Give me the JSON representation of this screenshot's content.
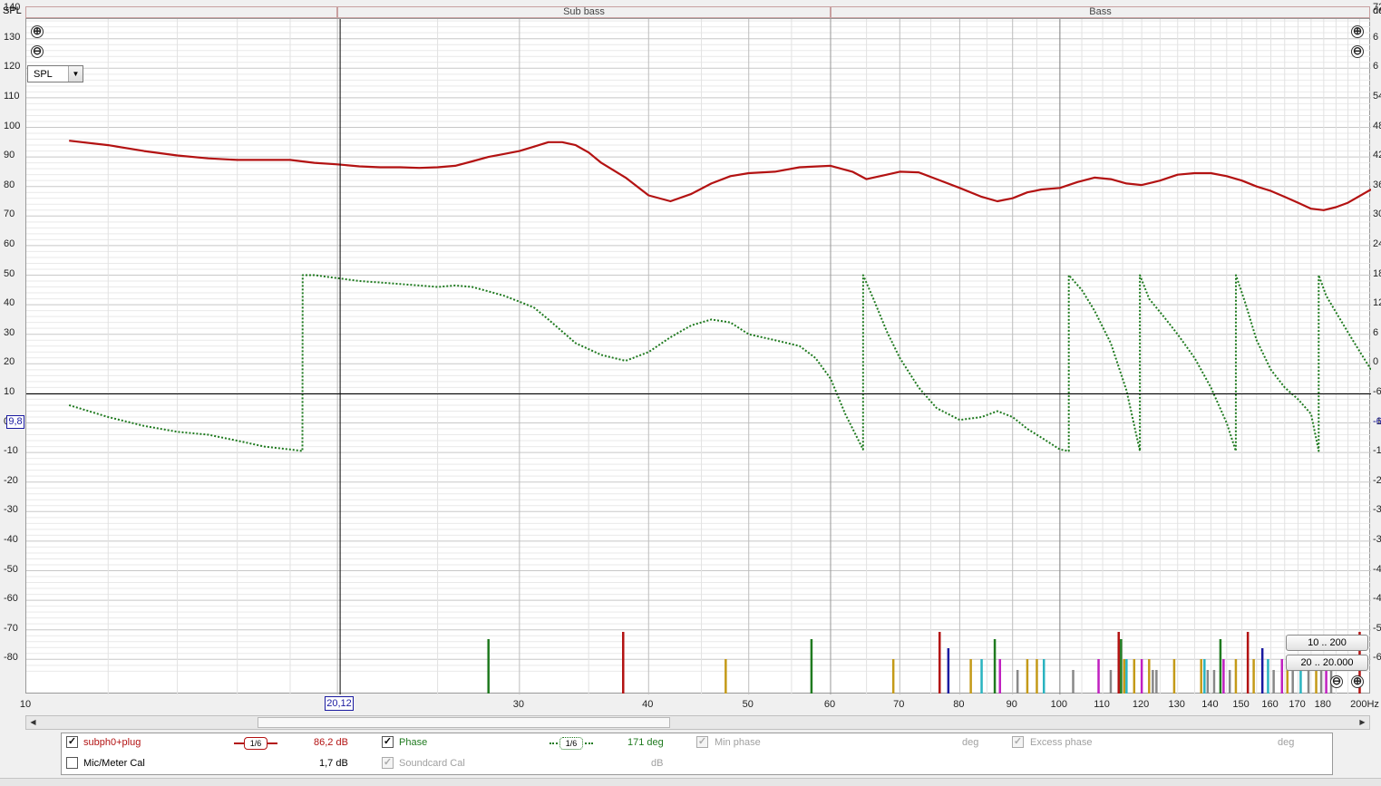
{
  "top_axis_label": "SPL",
  "top_right_label": "de",
  "bands": [
    {
      "label": "",
      "color": "#f79fd2"
    },
    {
      "label": "Sub bass",
      "color": "#f7a3a3"
    },
    {
      "label": "Bass",
      "color": "#f9dc96"
    }
  ],
  "y_ticks": [
    "140",
    "130",
    "120",
    "110",
    "100",
    "90",
    "80",
    "70",
    "60",
    "50",
    "40",
    "30",
    "20",
    "10",
    "0",
    "-10",
    "-20",
    "-30",
    "-40",
    "-50",
    "-60",
    "-70",
    "-80"
  ],
  "y_ticks_right": [
    "72",
    "6",
    "6",
    "54",
    "48",
    "42",
    "36",
    "30",
    "24",
    "18",
    "12",
    "6",
    "0",
    "-6",
    "-12",
    "-18",
    "-24",
    "-30",
    "-36",
    "-42",
    "-48",
    "-54",
    "-6"
  ],
  "x_ticks": [
    "10",
    "20",
    "30",
    "40",
    "50",
    "60",
    "70",
    "80",
    "90",
    "100",
    "110",
    "120",
    "130",
    "140",
    "150",
    "160",
    "170",
    "180",
    "200Hz"
  ],
  "cursor": {
    "x_label": "20,12",
    "y_label": "9,8",
    "right_label": "-6"
  },
  "spl_select": {
    "value": "SPL"
  },
  "zoom_buttons": {
    "plus": "⊕",
    "minus": "⊖"
  },
  "range_buttons": [
    "10 .. 200",
    "20 .. 20.000"
  ],
  "legend": {
    "meas_name": "subph0+plug",
    "meas_value": "86,2 dB",
    "smoothing_1": "1/6",
    "phase_label": "Phase",
    "smoothing_2": "1/6",
    "phase_value": "171 deg",
    "min_phase_label": "Min phase",
    "min_phase_unit": "deg",
    "excess_phase_label": "Excess phase",
    "excess_phase_unit": "deg",
    "mic_cal_label": "Mic/Meter Cal",
    "mic_cal_value": "1,7 dB",
    "soundcard_cal_label": "Soundcard Cal",
    "soundcard_cal_unit": "dB"
  },
  "colors": {
    "spl_curve": "#b31212",
    "phase_curve": "#1f7a1f",
    "cursor_box": "#1a1aa0"
  },
  "chart_data": {
    "type": "line",
    "x_scale": "log",
    "xlim": [
      10,
      200
    ],
    "ylim": [
      -85,
      145
    ],
    "series": [
      {
        "name": "subph0+plug",
        "x": [
          11,
          12,
          13,
          14,
          15,
          16,
          17,
          18,
          19,
          20,
          21,
          22,
          23,
          24,
          25,
          26,
          27,
          28,
          29,
          30,
          31,
          32,
          33,
          34,
          35,
          36,
          38,
          40,
          42,
          44,
          46,
          48,
          50,
          53,
          56,
          60,
          63,
          65,
          68,
          70,
          73,
          76,
          80,
          84,
          87,
          90,
          93,
          96,
          100,
          104,
          108,
          112,
          116,
          120,
          125,
          130,
          135,
          140,
          145,
          150,
          155,
          160,
          165,
          170,
          175,
          180,
          185,
          190,
          200
        ],
        "y": [
          95.5,
          94,
          92,
          90.5,
          89.5,
          89,
          89,
          89,
          88,
          87.5,
          86.8,
          86.5,
          86.5,
          86.3,
          86.5,
          87,
          88.5,
          90,
          91,
          92,
          93.5,
          95,
          95,
          94,
          91.5,
          88,
          83,
          77,
          75,
          77.5,
          81,
          83.5,
          84.5,
          85,
          86.5,
          87,
          85,
          82.5,
          84,
          85,
          84.8,
          82.5,
          79.5,
          76.5,
          75,
          76,
          78,
          79,
          79.5,
          81.5,
          83,
          82.5,
          81,
          80.5,
          82,
          84,
          84.5,
          84.5,
          83.5,
          82,
          80,
          78.5,
          76.5,
          74.5,
          72.5,
          72,
          73,
          74.5,
          79
        ]
      },
      {
        "name": "Phase",
        "x": [
          11,
          12,
          13,
          14,
          15,
          16,
          17,
          18,
          18.5,
          18.51,
          19,
          20,
          21,
          22,
          23,
          24,
          25,
          26,
          27,
          28,
          29,
          30,
          31,
          32,
          34,
          36,
          38,
          40,
          42,
          44,
          46,
          48,
          50,
          53,
          56,
          58,
          60,
          62,
          64.5,
          64.51,
          66,
          68,
          70,
          73,
          76,
          80,
          84,
          87,
          90,
          93,
          96,
          100,
          102,
          102.01,
          105,
          108,
          112,
          116,
          119.5,
          119.51,
          122,
          126,
          130,
          135,
          140,
          145,
          148,
          148.01,
          151,
          155,
          160,
          165,
          170,
          175,
          178,
          178.01,
          181,
          186,
          192,
          200
        ],
        "y": [
          6,
          2,
          -1,
          -3,
          -4,
          -6,
          -8,
          -9,
          -9.5,
          50,
          50,
          49,
          48,
          47.5,
          47,
          46.5,
          46,
          46.5,
          46,
          44.5,
          43,
          41,
          39,
          35,
          27,
          23,
          21,
          24,
          29,
          33,
          35,
          34,
          30,
          28,
          26,
          22,
          15,
          3,
          -9,
          50,
          42,
          31,
          22,
          12,
          5,
          1,
          2,
          4,
          2,
          -2,
          -5,
          -9,
          -9.5,
          50,
          45,
          38,
          27,
          11,
          -9.5,
          50,
          42,
          36,
          30,
          22,
          12,
          0,
          -9.5,
          50,
          41,
          28,
          18,
          12,
          8,
          3,
          -9.5,
          50,
          43,
          36,
          28,
          18
        ]
      }
    ],
    "ir_markers": [
      {
        "x": 28,
        "h": 60,
        "color": "#1f7a1f"
      },
      {
        "x": 37.8,
        "h": 68,
        "color": "#b31212"
      },
      {
        "x": 47.5,
        "h": 38,
        "color": "#c49a18"
      },
      {
        "x": 57.5,
        "h": 60,
        "color": "#1f7a1f"
      },
      {
        "x": 69,
        "h": 38,
        "color": "#c49a18"
      },
      {
        "x": 76.5,
        "h": 68,
        "color": "#b31212"
      },
      {
        "x": 78,
        "h": 50,
        "color": "#1a1aa0"
      },
      {
        "x": 82,
        "h": 38,
        "color": "#c49a18"
      },
      {
        "x": 84,
        "h": 38,
        "color": "#2ab3c0"
      },
      {
        "x": 86.5,
        "h": 60,
        "color": "#1f7a1f"
      },
      {
        "x": 87.5,
        "h": 38,
        "color": "#c020c0"
      },
      {
        "x": 91,
        "h": 26,
        "color": "#888888"
      },
      {
        "x": 93,
        "h": 38,
        "color": "#c49a18"
      },
      {
        "x": 95,
        "h": 38,
        "color": "#c49a18"
      },
      {
        "x": 96.5,
        "h": 38,
        "color": "#2ab3c0"
      },
      {
        "x": 103,
        "h": 26,
        "color": "#888888"
      },
      {
        "x": 109,
        "h": 38,
        "color": "#c020c0"
      },
      {
        "x": 112,
        "h": 26,
        "color": "#888888"
      },
      {
        "x": 114,
        "h": 68,
        "color": "#b31212"
      },
      {
        "x": 114.6,
        "h": 60,
        "color": "#1f7a1f"
      },
      {
        "x": 115.4,
        "h": 38,
        "color": "#c49a18"
      },
      {
        "x": 116,
        "h": 38,
        "color": "#2ab3c0"
      },
      {
        "x": 118,
        "h": 38,
        "color": "#c49a18"
      },
      {
        "x": 120,
        "h": 38,
        "color": "#c020c0"
      },
      {
        "x": 122,
        "h": 38,
        "color": "#c49a18"
      },
      {
        "x": 123,
        "h": 26,
        "color": "#888888"
      },
      {
        "x": 124,
        "h": 26,
        "color": "#888888"
      },
      {
        "x": 129,
        "h": 38,
        "color": "#c49a18"
      },
      {
        "x": 137,
        "h": 38,
        "color": "#c49a18"
      },
      {
        "x": 138,
        "h": 38,
        "color": "#2ab3c0"
      },
      {
        "x": 139,
        "h": 26,
        "color": "#888888"
      },
      {
        "x": 141,
        "h": 26,
        "color": "#888888"
      },
      {
        "x": 143,
        "h": 60,
        "color": "#1f7a1f"
      },
      {
        "x": 144,
        "h": 38,
        "color": "#c020c0"
      },
      {
        "x": 146,
        "h": 26,
        "color": "#888888"
      },
      {
        "x": 148,
        "h": 38,
        "color": "#c49a18"
      },
      {
        "x": 152,
        "h": 68,
        "color": "#b31212"
      },
      {
        "x": 154,
        "h": 38,
        "color": "#c49a18"
      },
      {
        "x": 157,
        "h": 50,
        "color": "#1a1aa0"
      },
      {
        "x": 159,
        "h": 38,
        "color": "#2ab3c0"
      },
      {
        "x": 161,
        "h": 26,
        "color": "#888888"
      },
      {
        "x": 164,
        "h": 38,
        "color": "#c020c0"
      },
      {
        "x": 166,
        "h": 38,
        "color": "#c49a18"
      },
      {
        "x": 168,
        "h": 26,
        "color": "#888888"
      },
      {
        "x": 171,
        "h": 38,
        "color": "#2ab3c0"
      },
      {
        "x": 174,
        "h": 26,
        "color": "#888888"
      },
      {
        "x": 177,
        "h": 38,
        "color": "#c49a18"
      },
      {
        "x": 179,
        "h": 26,
        "color": "#888888"
      },
      {
        "x": 181,
        "h": 38,
        "color": "#c020c0"
      },
      {
        "x": 183,
        "h": 26,
        "color": "#888888"
      },
      {
        "x": 195,
        "h": 68,
        "color": "#b31212"
      }
    ]
  }
}
